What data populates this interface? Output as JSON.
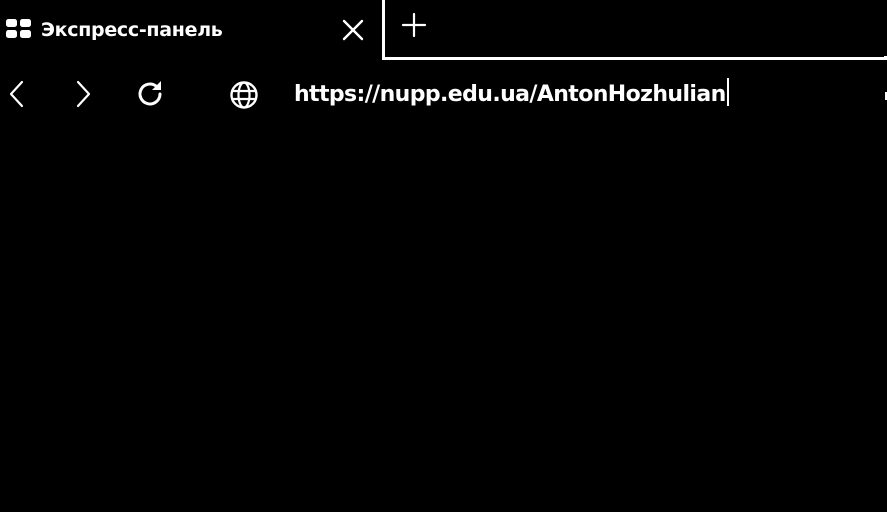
{
  "tab": {
    "title": "Экспресс-панель",
    "favicon_icon": "grid-icon",
    "close_icon": "close-icon"
  },
  "new_tab_icon": "plus-icon",
  "toolbar": {
    "back_icon": "chevron-left-icon",
    "forward_icon": "chevron-right-icon",
    "reload_icon": "reload-icon",
    "site_info_icon": "globe-icon"
  },
  "address_bar": {
    "url": "https://nupp.edu.ua/AntonHozhulian"
  },
  "colors": {
    "background": "#000000",
    "foreground": "#ffffff"
  }
}
